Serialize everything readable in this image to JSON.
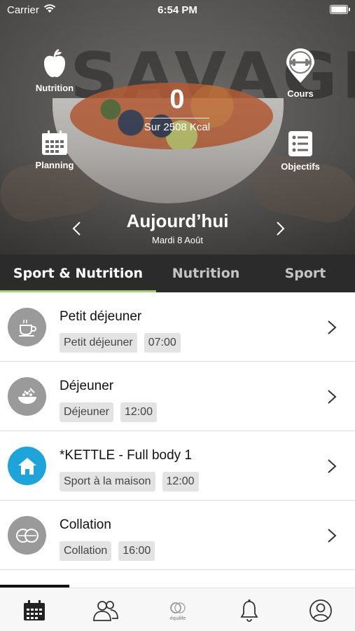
{
  "status_bar": {
    "carrier": "Carrier",
    "time": "6:54 PM"
  },
  "hero": {
    "nutrition_label": "Nutrition",
    "cours_label": "Cours",
    "planning_label": "Planning",
    "objectifs_label": "Objectifs",
    "kcal_value": "0",
    "kcal_total": "Sur 2508 Kcal",
    "day_title": "Aujourd’hui",
    "day_date": "Mardi 8 Août"
  },
  "tabs": [
    {
      "label": "Sport & Nutrition",
      "active": true
    },
    {
      "label": "Nutrition",
      "active": false
    },
    {
      "label": "Sport",
      "active": false
    }
  ],
  "items": [
    {
      "title": "Petit déjeuner",
      "tag": "Petit déjeuner",
      "time": "07:00",
      "icon": "coffee-cup-icon"
    },
    {
      "title": "Déjeuner",
      "tag": "Déjeuner",
      "time": "12:00",
      "icon": "salad-bowl-icon"
    },
    {
      "title": "*KETTLE - Full body 1",
      "tag": "Sport à la maison",
      "time": "12:00",
      "icon": "house-icon"
    },
    {
      "title": "Collation",
      "tag": "Collation",
      "time": "16:00",
      "icon": "cookies-icon"
    }
  ],
  "bottom_nav": {
    "brand": "équilife"
  },
  "colors": {
    "tab_bar_bg": "#2b2b2b",
    "tab_indicator": "#a8cf6e",
    "sport_icon_bg": "#1ea4d8",
    "meal_icon_bg": "#9a9a9a"
  }
}
